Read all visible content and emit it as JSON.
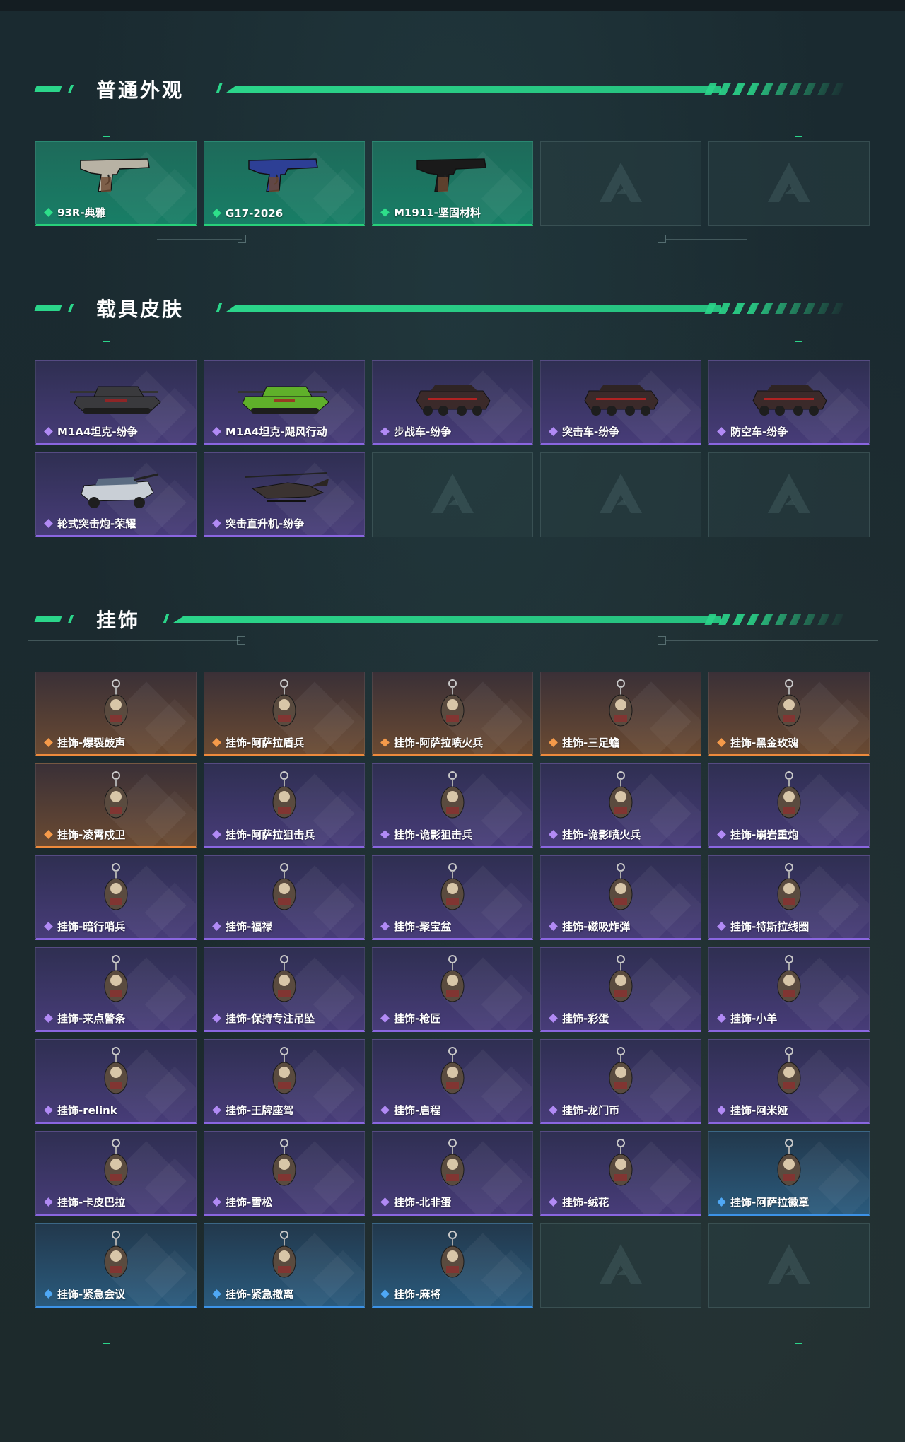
{
  "sections": [
    {
      "title": "普通外观",
      "items": [
        {
          "label": "93R-典雅",
          "rarity": "green",
          "icon": "pistol-silver-icon"
        },
        {
          "label": "G17-2026",
          "rarity": "green",
          "icon": "pistol-blue-icon"
        },
        {
          "label": "M1911-坚固材料",
          "rarity": "green",
          "icon": "pistol-black-icon"
        },
        {
          "label": "",
          "rarity": "empty",
          "icon": "empty-slot-logo"
        },
        {
          "label": "",
          "rarity": "empty",
          "icon": "empty-slot-logo"
        }
      ]
    },
    {
      "title": "载具皮肤",
      "items": [
        {
          "label": "M1A4坦克-纷争",
          "rarity": "purple",
          "icon": "tank-icon"
        },
        {
          "label": "M1A4坦克-飓风行动",
          "rarity": "purple",
          "icon": "tank-green-icon"
        },
        {
          "label": "步战车-纷争",
          "rarity": "purple",
          "icon": "armored-vehicle-icon"
        },
        {
          "label": "突击车-纷争",
          "rarity": "purple",
          "icon": "assault-vehicle-icon"
        },
        {
          "label": "防空车-纷争",
          "rarity": "purple",
          "icon": "antiair-vehicle-icon"
        },
        {
          "label": "轮式突击炮-荣耀",
          "rarity": "purple",
          "icon": "wheeled-gun-icon"
        },
        {
          "label": "突击直升机-纷争",
          "rarity": "purple",
          "icon": "helicopter-icon"
        },
        {
          "label": "",
          "rarity": "empty",
          "icon": "empty-slot-logo"
        },
        {
          "label": "",
          "rarity": "empty",
          "icon": "empty-slot-logo"
        },
        {
          "label": "",
          "rarity": "empty",
          "icon": "empty-slot-logo"
        }
      ]
    },
    {
      "title": "挂饰",
      "items": [
        {
          "label": "挂饰-爆裂鼓声",
          "rarity": "orange",
          "icon": "charm-icon"
        },
        {
          "label": "挂饰-阿萨拉盾兵",
          "rarity": "orange",
          "icon": "charm-icon"
        },
        {
          "label": "挂饰-阿萨拉喷火兵",
          "rarity": "orange",
          "icon": "charm-icon"
        },
        {
          "label": "挂饰-三足蟾",
          "rarity": "orange",
          "icon": "charm-icon"
        },
        {
          "label": "挂饰-黑金玫瑰",
          "rarity": "orange",
          "icon": "charm-icon"
        },
        {
          "label": "挂饰-凌霄戍卫",
          "rarity": "orange",
          "icon": "charm-icon"
        },
        {
          "label": "挂饰-阿萨拉狙击兵",
          "rarity": "purple",
          "icon": "charm-icon"
        },
        {
          "label": "挂饰-诡影狙击兵",
          "rarity": "purple",
          "icon": "charm-icon"
        },
        {
          "label": "挂饰-诡影喷火兵",
          "rarity": "purple",
          "icon": "charm-icon"
        },
        {
          "label": "挂饰-崩岩重炮",
          "rarity": "purple",
          "icon": "charm-icon"
        },
        {
          "label": "挂饰-暗行哨兵",
          "rarity": "purple",
          "icon": "charm-icon"
        },
        {
          "label": "挂饰-福禄",
          "rarity": "purple",
          "icon": "charm-icon"
        },
        {
          "label": "挂饰-聚宝盆",
          "rarity": "purple",
          "icon": "charm-icon"
        },
        {
          "label": "挂饰-磁吸炸弹",
          "rarity": "purple",
          "icon": "charm-icon"
        },
        {
          "label": "挂饰-特斯拉线圈",
          "rarity": "purple",
          "icon": "charm-icon"
        },
        {
          "label": "挂饰-来点警条",
          "rarity": "purple",
          "icon": "charm-icon"
        },
        {
          "label": "挂饰-保持专注吊坠",
          "rarity": "purple",
          "icon": "charm-icon"
        },
        {
          "label": "挂饰-枪匠",
          "rarity": "purple",
          "icon": "charm-icon"
        },
        {
          "label": "挂饰-彩蛋",
          "rarity": "purple",
          "icon": "charm-icon"
        },
        {
          "label": "挂饰-小羊",
          "rarity": "purple",
          "icon": "charm-icon"
        },
        {
          "label": "挂饰-relink",
          "rarity": "purple",
          "icon": "charm-icon"
        },
        {
          "label": "挂饰-王牌座驾",
          "rarity": "purple",
          "icon": "charm-icon"
        },
        {
          "label": "挂饰-启程",
          "rarity": "purple",
          "icon": "charm-icon"
        },
        {
          "label": "挂饰-龙门币",
          "rarity": "purple",
          "icon": "charm-icon"
        },
        {
          "label": "挂饰-阿米娅",
          "rarity": "purple",
          "icon": "charm-icon"
        },
        {
          "label": "挂饰-卡皮巴拉",
          "rarity": "purple",
          "icon": "charm-icon"
        },
        {
          "label": "挂饰-雪松",
          "rarity": "purple",
          "icon": "charm-icon"
        },
        {
          "label": "挂饰-北非蛋",
          "rarity": "purple",
          "icon": "charm-icon"
        },
        {
          "label": "挂饰-绒花",
          "rarity": "purple",
          "icon": "charm-icon"
        },
        {
          "label": "挂饰-阿萨拉徽章",
          "rarity": "blue",
          "icon": "charm-icon"
        },
        {
          "label": "挂饰-紧急会议",
          "rarity": "blue",
          "icon": "charm-icon"
        },
        {
          "label": "挂饰-紧急撤离",
          "rarity": "blue",
          "icon": "charm-icon"
        },
        {
          "label": "挂饰-麻将",
          "rarity": "blue",
          "icon": "charm-icon"
        },
        {
          "label": "",
          "rarity": "empty",
          "icon": "empty-slot-logo"
        },
        {
          "label": "",
          "rarity": "empty",
          "icon": "empty-slot-logo"
        }
      ]
    }
  ],
  "colors": {
    "accent": "#2bd58a",
    "green": "#28d07a",
    "purple": "#8a66e0",
    "orange": "#ee8a3c",
    "blue": "#3c92e6"
  }
}
